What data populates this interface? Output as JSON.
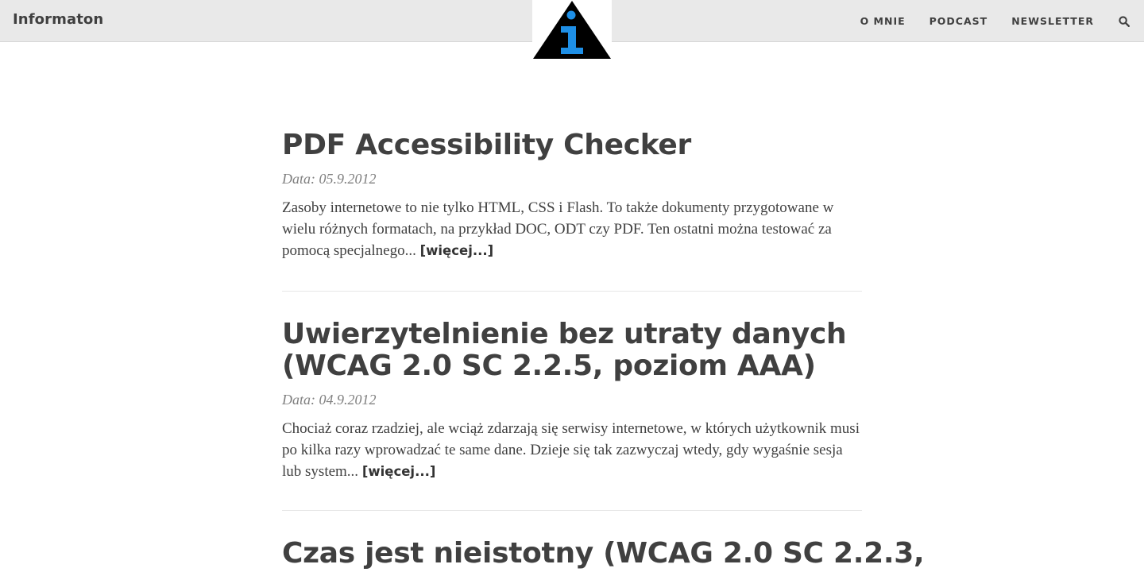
{
  "site": {
    "brand": "Informaton",
    "logo_icon": "info-triangle-logo",
    "colors": {
      "logo_triangle": "#000000",
      "logo_letter": "#1e8fe6",
      "nav_bg": "#e9e9e9",
      "text": "#404040",
      "meta": "#808080"
    }
  },
  "nav": {
    "items": [
      {
        "label": "O MNIE"
      },
      {
        "label": "PODCAST"
      },
      {
        "label": "NEWSLETTER"
      }
    ],
    "search_icon": "search-icon"
  },
  "posts": [
    {
      "title": "PDF Accessibility Checker",
      "date": "Data: 05.9.2012",
      "excerpt": "Zasoby internetowe to nie tylko HTML, CSS i Flash. To także dokumenty przygotowane w wielu różnych formatach, na przykład DOC, ODT czy PDF. Ten ostatni można testować za pomocą specjalnego...",
      "more": "[więcej...]"
    },
    {
      "title": "Uwierzytelnienie bez utraty danych (WCAG 2.0 SC 2.2.5, poziom AAA)",
      "date": "Data: 04.9.2012",
      "excerpt": "Chociaż coraz rzadziej, ale wciąż zdarzają się serwisy internetowe, w których użytkownik musi po kilka razy wprowadzać te same dane. Dzieje się tak zazwyczaj wtedy, gdy wygaśnie sesja lub system...",
      "more": "[więcej...]"
    },
    {
      "title": "Czas jest nieistotny (WCAG 2.0 SC 2.2.3,"
    }
  ]
}
